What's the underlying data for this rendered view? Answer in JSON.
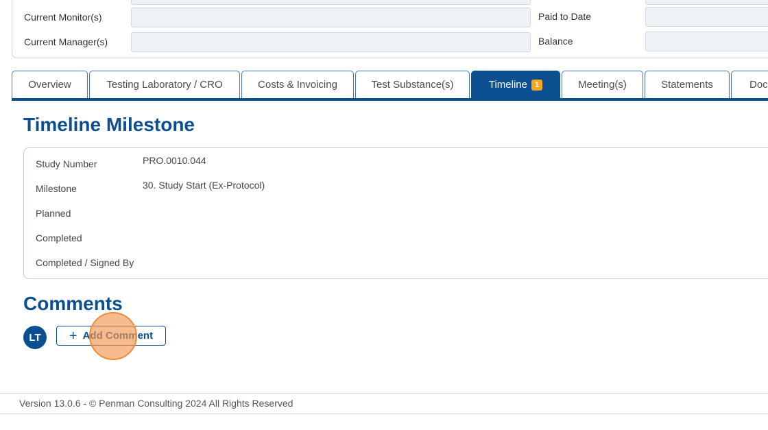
{
  "summary": {
    "current_monitors_label": "Current Monitor(s)",
    "current_managers_label": "Current Manager(s)",
    "paid_to_date_label": "Paid to Date",
    "balance_label": "Balance"
  },
  "tabs": [
    {
      "label": "Overview"
    },
    {
      "label": "Testing Laboratory / CRO"
    },
    {
      "label": "Costs & Invoicing"
    },
    {
      "label": "Test Substance(s)"
    },
    {
      "label": "Timeline",
      "badge": "1",
      "active": true
    },
    {
      "label": "Meeting(s)"
    },
    {
      "label": "Statements"
    },
    {
      "label": "Docu"
    }
  ],
  "milestone": {
    "title": "Timeline Milestone",
    "study_number_label": "Study Number",
    "study_number_value": "PRO.0010.044",
    "milestone_label": "Milestone",
    "milestone_value": "30. Study Start (Ex-Protocol)",
    "planned_label": "Planned",
    "completed_label": "Completed",
    "signed_by_label": "Completed / Signed By"
  },
  "comments": {
    "title": "Comments",
    "avatar_initials": "LT",
    "add_label": "Add Comment"
  },
  "footer": {
    "text": "Version 13.0.6 - © Penman Consulting 2024 All Rights Reserved"
  },
  "colors": {
    "brand": "#0b4f91",
    "badge": "#f5a623"
  }
}
